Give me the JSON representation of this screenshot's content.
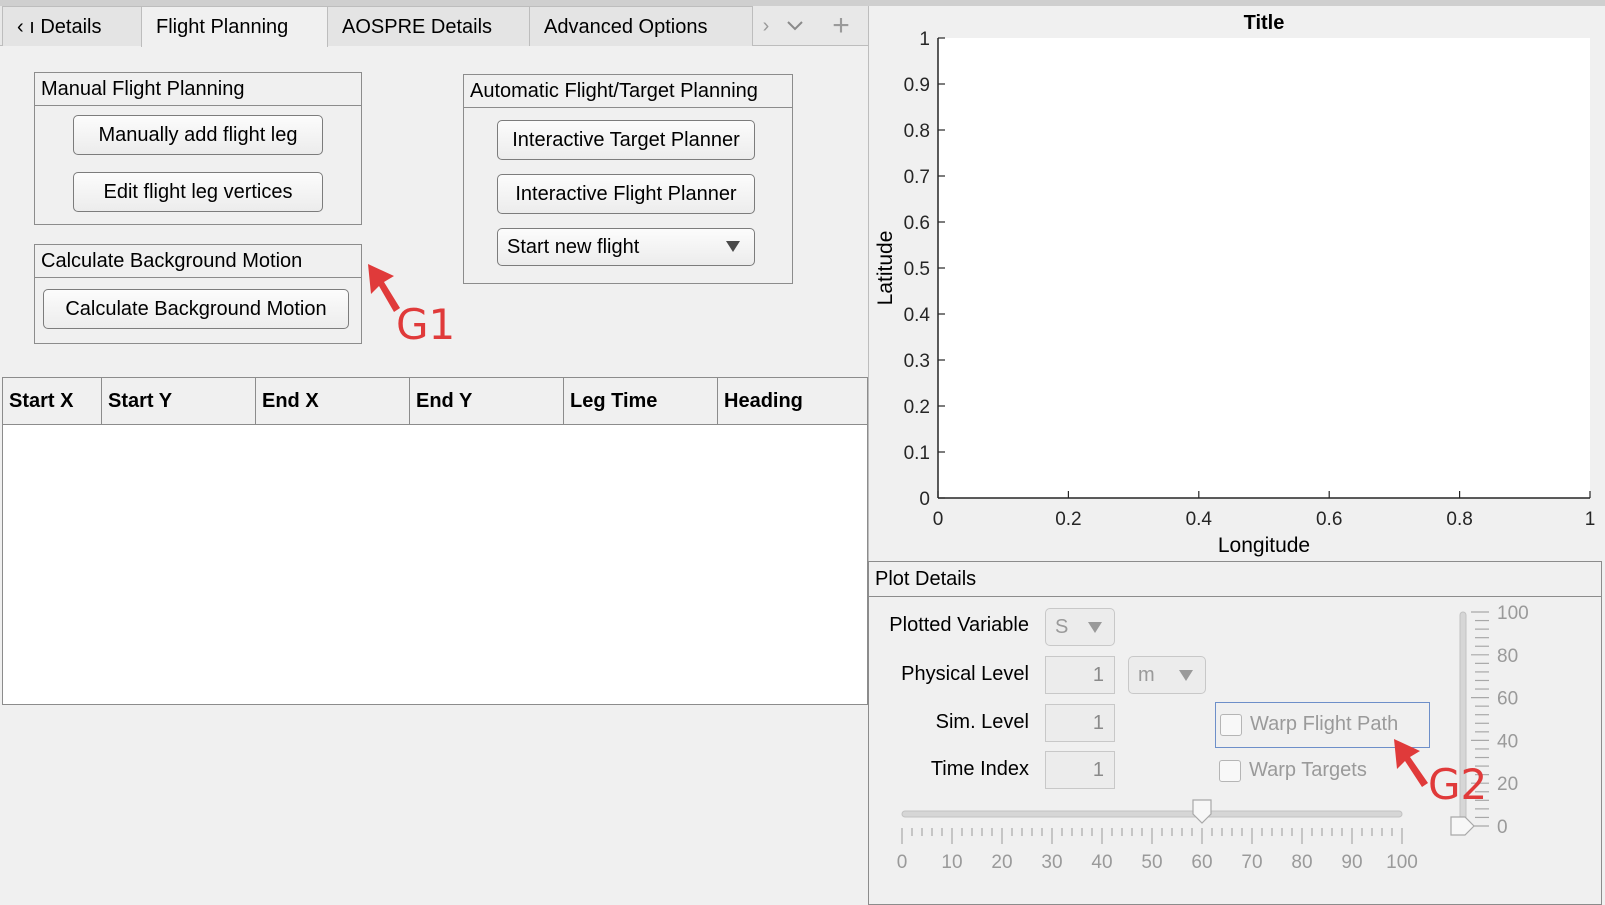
{
  "tabs": {
    "items": [
      {
        "label": "‹ ı Details"
      },
      {
        "label": "Flight Planning"
      },
      {
        "label": "AOSPRE Details"
      },
      {
        "label": "Advanced Options"
      }
    ],
    "active_index": 1
  },
  "manual": {
    "title": "Manual Flight Planning",
    "add_leg": "Manually add flight leg",
    "edit_vertices": "Edit flight leg vertices"
  },
  "background": {
    "title": "Calculate Background Motion",
    "button": "Calculate Background Motion"
  },
  "automatic": {
    "title": "Automatic Flight/Target Planning",
    "target_planner": "Interactive Target Planner",
    "flight_planner": "Interactive Flight Planner",
    "flight_select": "Start new flight"
  },
  "table": {
    "columns": [
      "Start X",
      "Start Y",
      "End X",
      "End Y",
      "Leg Time",
      "Heading"
    ],
    "rows": []
  },
  "chart_data": {
    "type": "line",
    "title": "Title",
    "xlabel": "Longitude",
    "ylabel": "Latitude",
    "xlim": [
      0,
      1
    ],
    "ylim": [
      0,
      1
    ],
    "xticks": [
      "0",
      "0.2",
      "0.4",
      "0.6",
      "0.8",
      "1"
    ],
    "yticks": [
      "0",
      "0.1",
      "0.2",
      "0.3",
      "0.4",
      "0.5",
      "0.6",
      "0.7",
      "0.8",
      "0.9",
      "1"
    ],
    "series": []
  },
  "plot_details": {
    "title": "Plot Details",
    "plotted_variable_label": "Plotted Variable",
    "plotted_variable_value": "S",
    "physical_level_label": "Physical Level",
    "physical_level_value": "1",
    "physical_level_unit": "m",
    "sim_level_label": "Sim. Level",
    "sim_level_value": "1",
    "time_index_label": "Time Index",
    "time_index_value": "1",
    "warp_flight_path": "Warp Flight Path",
    "warp_targets": "Warp Targets",
    "h_slider_ticks": [
      "0",
      "10",
      "20",
      "30",
      "40",
      "50",
      "60",
      "70",
      "80",
      "90",
      "100"
    ],
    "h_slider_value": 60,
    "v_slider_ticks": [
      "0",
      "20",
      "40",
      "60",
      "80",
      "100"
    ],
    "v_slider_value": 0
  },
  "annotations": {
    "g1": "G1",
    "g2": "G2",
    "color": "#e03a3a"
  }
}
